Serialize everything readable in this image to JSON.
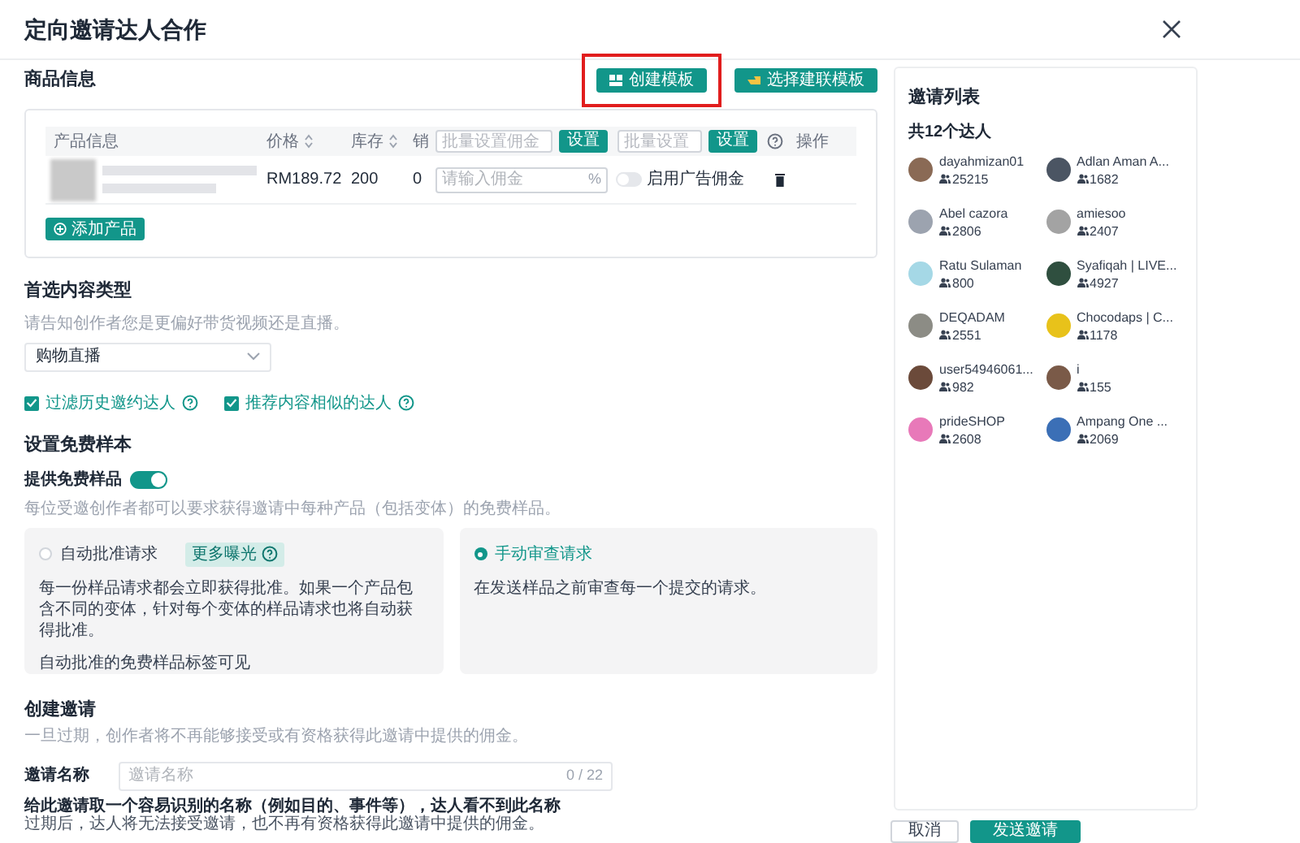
{
  "window": {
    "title": "定向邀请达人合作"
  },
  "product_section": {
    "title": "商品信息",
    "buttons": [
      {
        "label": "创建模板",
        "highlighted": true
      },
      {
        "label": "选择建联模板",
        "highlighted": false
      }
    ],
    "table": {
      "columns": [
        {
          "label": "产品信息",
          "sortable": false
        },
        {
          "label": "价格",
          "sortable": true
        },
        {
          "label": "库存",
          "sortable": true
        },
        {
          "label": "销",
          "sortable": false
        }
      ],
      "bulk_commission": {
        "placeholder": "批量设置佣金",
        "button": "设置"
      },
      "bulk_set": {
        "placeholder": "批量设置",
        "button": "设置"
      },
      "action_column": "操作",
      "rows": [
        {
          "price": "RM189.72",
          "stock": "200",
          "sales": "0",
          "commission_placeholder": "请输入佣金",
          "commission_unit": "%",
          "ad_commission": {
            "label": "启用广告佣金",
            "on": false
          }
        }
      ]
    },
    "add_button": "添加产品"
  },
  "content_type": {
    "title": "首选内容类型",
    "hint": "请告知创作者您是更偏好带货视频还是直播。",
    "select_value": "购物直播",
    "options": [
      {
        "label": "过滤历史邀约达人",
        "checked": true
      },
      {
        "label": "推荐内容相似的达人",
        "checked": true
      }
    ]
  },
  "samples": {
    "title": "设置免费样本",
    "toggle": {
      "label": "提供免费样品",
      "on": true
    },
    "hint": "每位受邀创作者都可以要求获得邀请中每种产品（包括变体）的免费样品。",
    "choices": [
      {
        "label": "自动批准请求",
        "selected": false,
        "badge": "更多曝光",
        "description": "每一份样品请求都会立即获得批准。如果一个产品包含不同的变体，针对每个变体的样品请求也将自动获得批准。",
        "note": "自动批准的免费样品标签可见"
      },
      {
        "label": "手动审查请求",
        "selected": true,
        "description": "在发送样品之前审查每一个提交的请求。"
      }
    ]
  },
  "invitation": {
    "title": "创建邀请",
    "hint": "一旦过期，创作者将不再能够接受或有资格获得此邀请中提供的佣金。",
    "name_label": "邀请名称",
    "name_placeholder": "邀请名称",
    "name_counter": "0 / 22",
    "name_help": "给此邀请取一个容易识别的名称（例如目的、事件等），达人看不到此名称",
    "expiry_help": "过期后，达人将无法接受邀请，也不再有资格获得此邀请中提供的佣金。"
  },
  "invite_list": {
    "title": "邀请列表",
    "count": "共12个达人",
    "creators": [
      {
        "name": "dayahmizan01",
        "followers": "25215",
        "color": "#8a6a55"
      },
      {
        "name": "Adlan Aman A...",
        "followers": "1682",
        "color": "#4b5563"
      },
      {
        "name": "Abel cazora",
        "followers": "2806",
        "color": "#9ca3af"
      },
      {
        "name": "amiesoo",
        "followers": "2407",
        "color": "#a3a3a3"
      },
      {
        "name": "Ratu Sulaman",
        "followers": "800",
        "color": "#a5d8e6"
      },
      {
        "name": "Syafiqah | LIVE...",
        "followers": "4927",
        "color": "#2f4f3f"
      },
      {
        "name": "DEQADAM",
        "followers": "2551",
        "color": "#8c8c85"
      },
      {
        "name": "Chocodaps | C...",
        "followers": "1178",
        "color": "#e8c21a"
      },
      {
        "name": "user54946061...",
        "followers": "982",
        "color": "#6b4a3a"
      },
      {
        "name": "i",
        "followers": "155",
        "color": "#7a5a48"
      },
      {
        "name": "prideSHOP",
        "followers": "2608",
        "color": "#e879b9"
      },
      {
        "name": "Ampang One ...",
        "followers": "2069",
        "color": "#3b6fb6"
      }
    ]
  },
  "footer": {
    "buttons": [
      {
        "label": "取消",
        "kind": "secondary"
      },
      {
        "label": "发送邀请",
        "kind": "primary"
      }
    ]
  }
}
